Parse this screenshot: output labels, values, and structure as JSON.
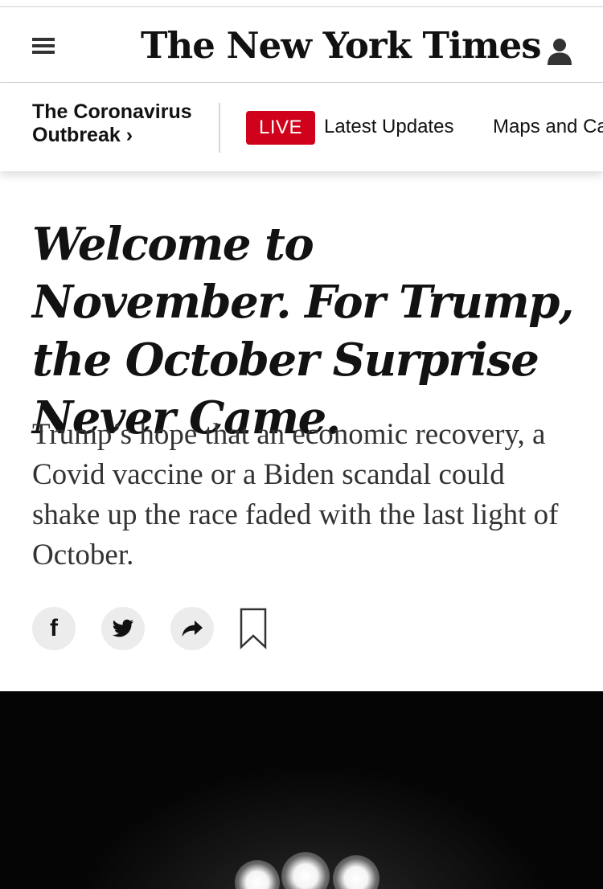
{
  "masthead": {
    "logo_text": "The New York Times",
    "menu_icon": "hamburger-menu-icon",
    "account_icon": "user-account-icon"
  },
  "storybar": {
    "title": "The Coronavirus Outbreak ›",
    "live_label": "LIVE",
    "links": [
      "Latest Updates",
      "Maps and Ca"
    ]
  },
  "article": {
    "headline": "Welcome to November. For Trump, the October Surprise Never Came.",
    "summary": "Trump’s hope that an economic recovery, a Covid vaccine or a Biden scandal could shake up the race faded with the last light of October."
  },
  "share": {
    "icons": [
      "facebook-icon",
      "twitter-icon",
      "share-arrow-icon",
      "bookmark-icon"
    ]
  },
  "colors": {
    "live_red": "#d0021b",
    "text": "#121212",
    "summary_text": "#333333",
    "share_bg": "#ececec"
  }
}
